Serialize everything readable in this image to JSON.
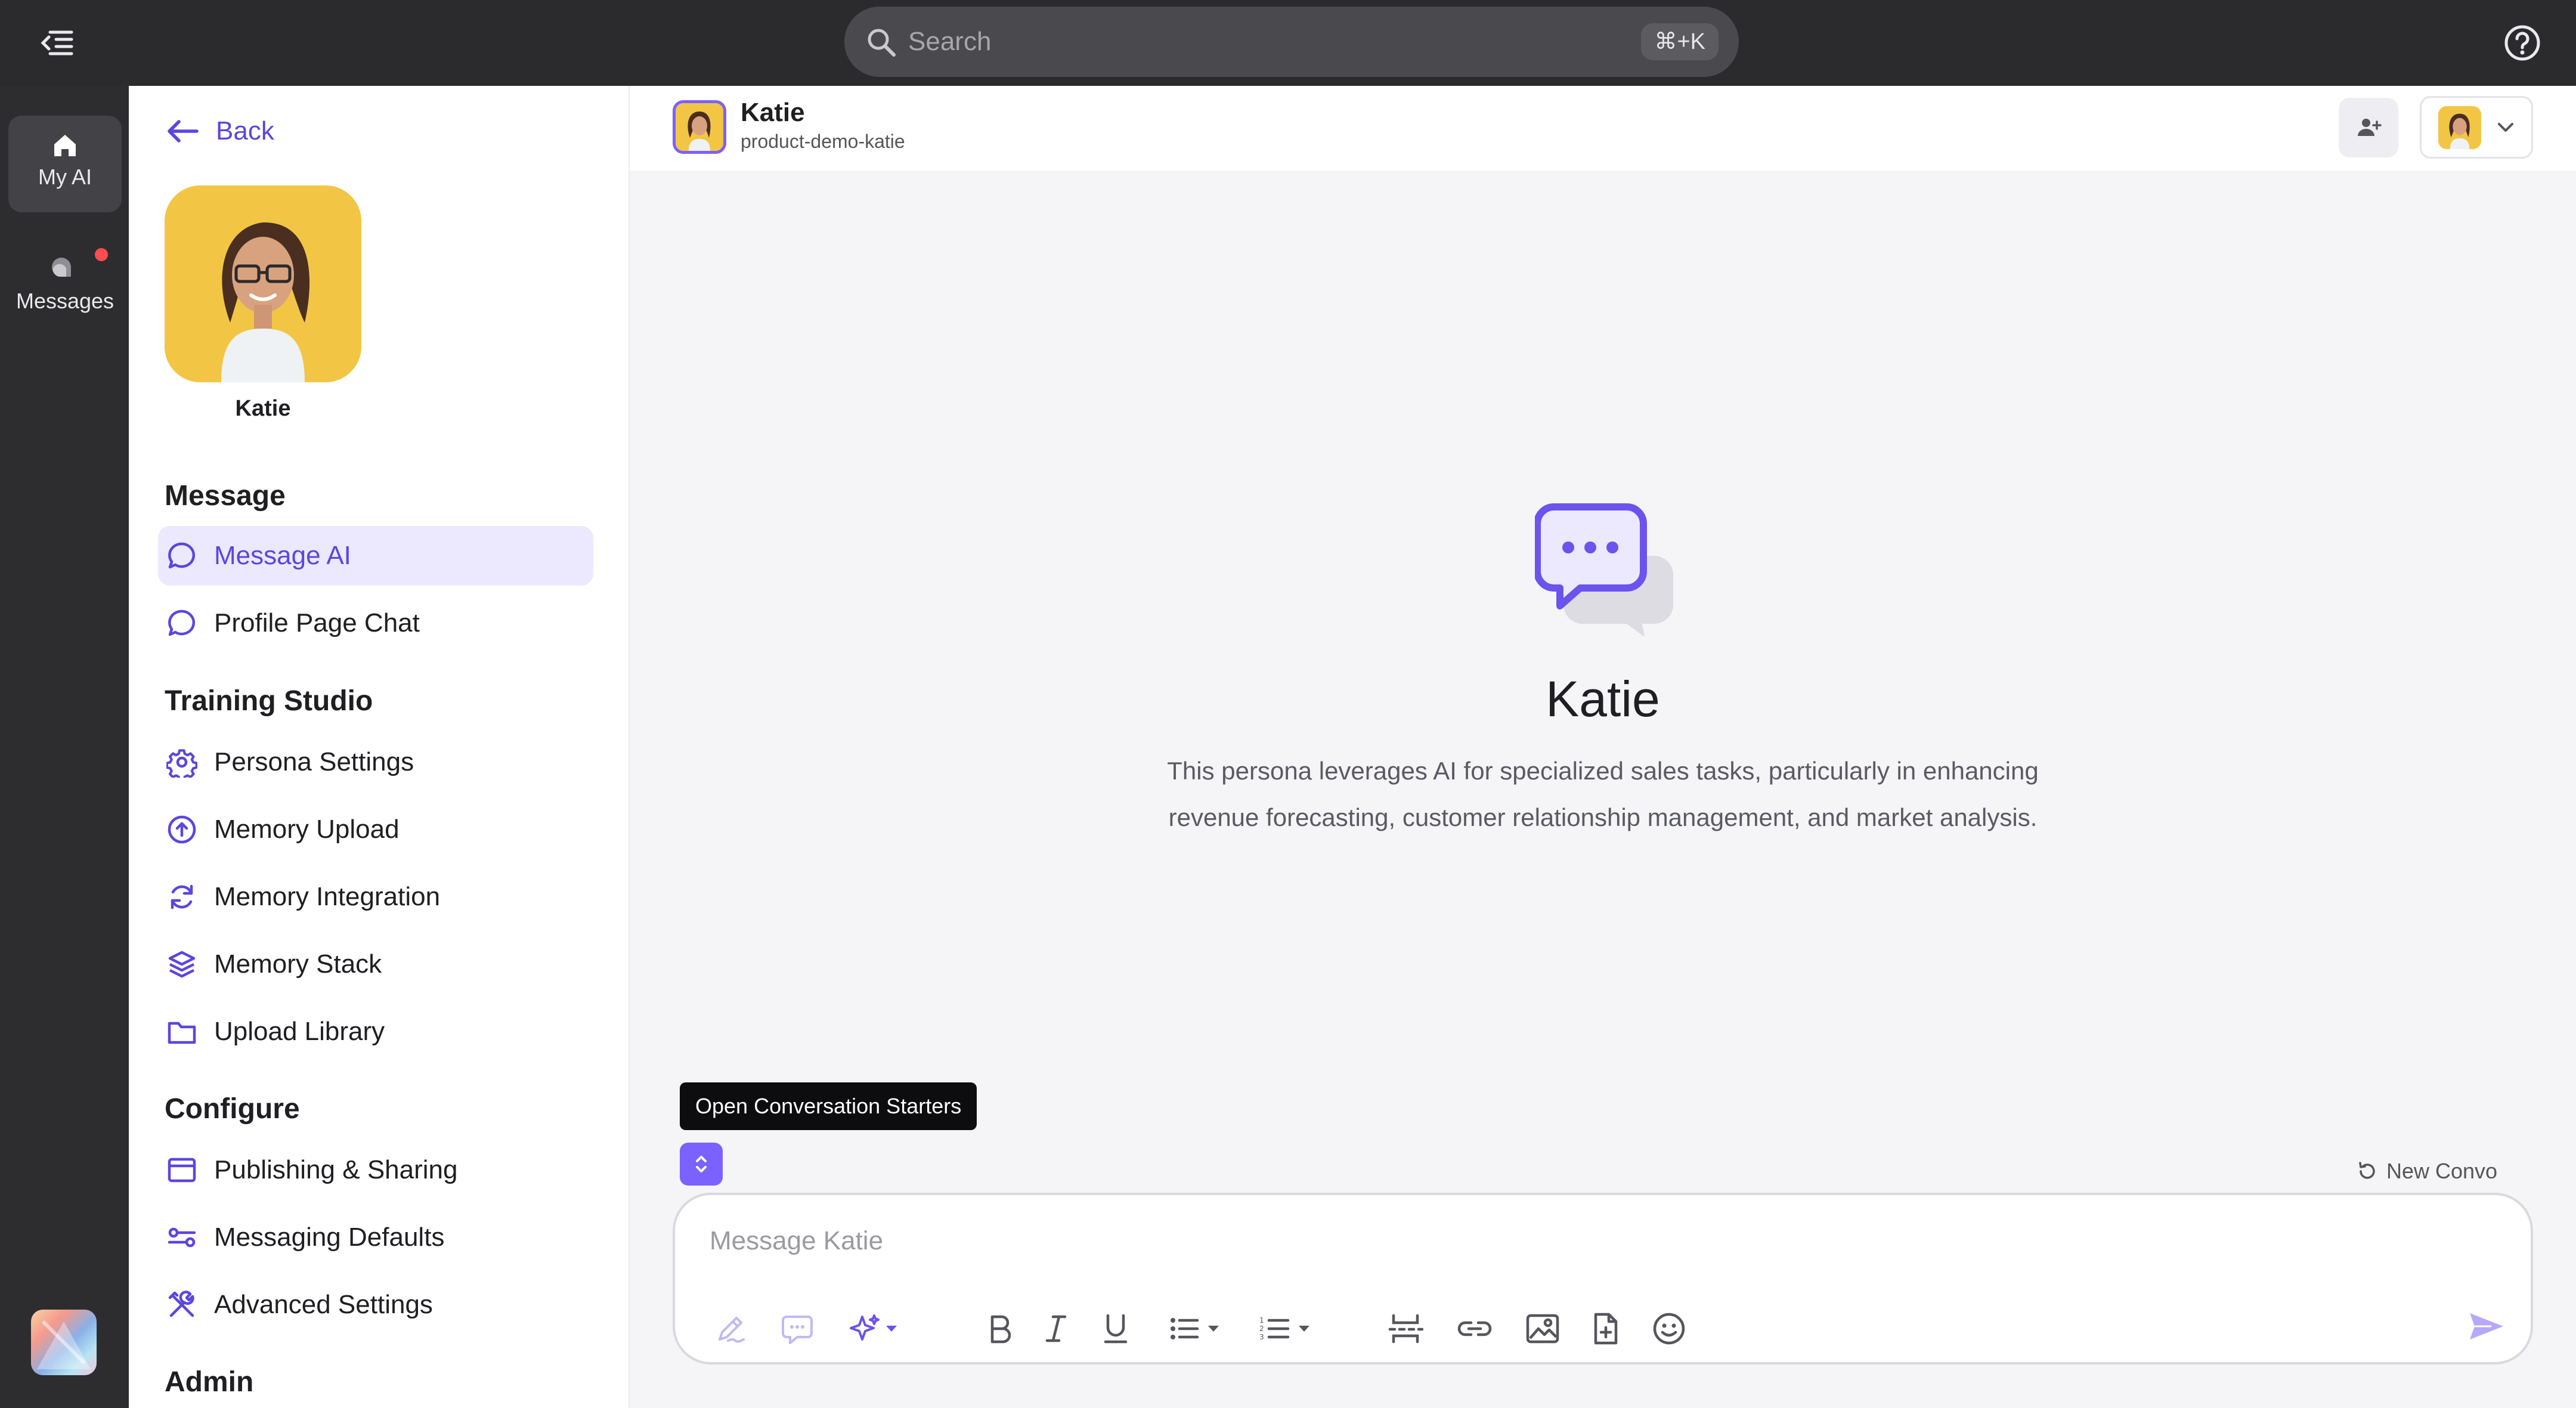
{
  "search": {
    "placeholder": "Search",
    "shortcut": "⌘+K"
  },
  "rail": {
    "items": [
      {
        "label": "My AI"
      },
      {
        "label": "Messages"
      }
    ]
  },
  "panel": {
    "back_label": "Back",
    "persona_name": "Katie",
    "sections": [
      {
        "heading": "Message",
        "items": [
          {
            "label": "Message AI"
          },
          {
            "label": "Profile Page Chat"
          }
        ]
      },
      {
        "heading": "Training Studio",
        "items": [
          {
            "label": "Persona Settings"
          },
          {
            "label": "Memory Upload"
          },
          {
            "label": "Memory Integration"
          },
          {
            "label": "Memory Stack"
          },
          {
            "label": "Upload Library"
          }
        ]
      },
      {
        "heading": "Configure",
        "items": [
          {
            "label": "Publishing & Sharing"
          },
          {
            "label": "Messaging Defaults"
          },
          {
            "label": "Advanced Settings"
          }
        ]
      },
      {
        "heading": "Admin",
        "items": []
      }
    ]
  },
  "header": {
    "name": "Katie",
    "handle": "product-demo-katie"
  },
  "hero": {
    "title": "Katie",
    "description": "This persona leverages AI for specialized sales tasks, particularly in enhancing revenue forecasting, customer relationship management, and market analysis."
  },
  "composer": {
    "tooltip": "Open Conversation Starters",
    "new_convo_label": "New Convo",
    "placeholder": "Message Katie"
  },
  "colors": {
    "accent": "#5b46df",
    "accent_light": "#ece9fe",
    "avatar_bg": "#f2c644",
    "topbar": "#2b2b2e"
  }
}
